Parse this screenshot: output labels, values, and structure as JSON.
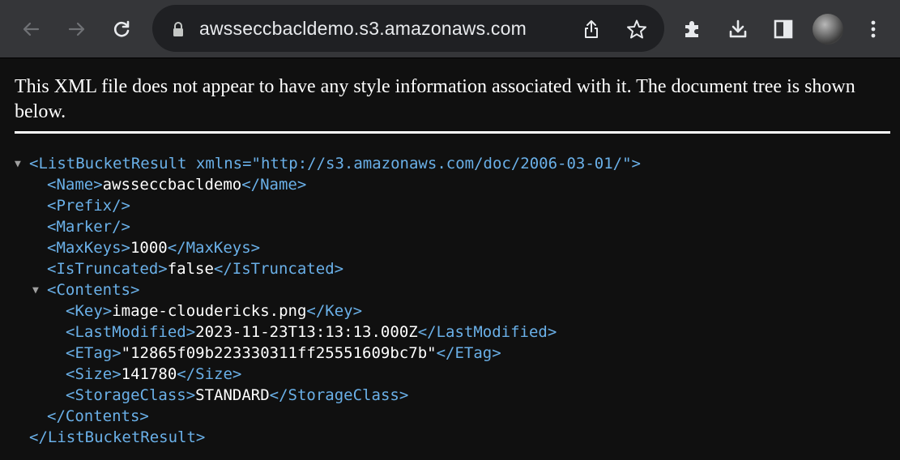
{
  "browser": {
    "url": "awsseccbacldemo.s3.amazonaws.com"
  },
  "page": {
    "notice": "This XML file does not appear to have any style information associated with it. The document tree is shown below."
  },
  "xml": {
    "root_open_tag": "<ListBucketResult xmlns=\"http://s3.amazonaws.com/doc/2006-03-01/\">",
    "name_open": "<Name>",
    "name_value": "awsseccbacldemo",
    "name_close": "</Name>",
    "prefix": "<Prefix/>",
    "marker": "<Marker/>",
    "maxkeys_open": "<MaxKeys>",
    "maxkeys_value": "1000",
    "maxkeys_close": "</MaxKeys>",
    "istruncated_open": "<IsTruncated>",
    "istruncated_value": "false",
    "istruncated_close": "</IsTruncated>",
    "contents_open": "<Contents>",
    "key_open": "<Key>",
    "key_value": "image-cloudericks.png",
    "key_close": "</Key>",
    "lastmodified_open": "<LastModified>",
    "lastmodified_value": "2023-11-23T13:13:13.000Z",
    "lastmodified_close": "</LastModified>",
    "etag_open": "<ETag>",
    "etag_value": "\"12865f09b223330311ff25551609bc7b\"",
    "etag_close": "</ETag>",
    "size_open": "<Size>",
    "size_value": "141780",
    "size_close": "</Size>",
    "storageclass_open": "<StorageClass>",
    "storageclass_value": "STANDARD",
    "storageclass_close": "</StorageClass>",
    "contents_close": "</Contents>",
    "root_close": "</ListBucketResult>"
  },
  "icons": {
    "back": "arrow-left",
    "forward": "arrow-right",
    "reload": "reload",
    "lock": "lock",
    "share": "share",
    "bookmark": "star",
    "extensions": "puzzle-piece",
    "downloads": "download",
    "side_panel": "side-panel",
    "menu": "three-dots-vertical"
  },
  "colors": {
    "toolbar": "#353639",
    "omnibox": "#1f2023",
    "page_background": "#101010",
    "xml_tag": "#6ab0e8",
    "xml_text": "#ffffff"
  }
}
